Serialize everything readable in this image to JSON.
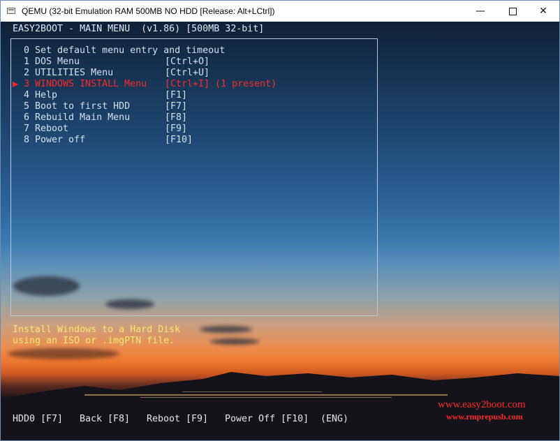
{
  "window": {
    "title": "QEMU (32-bit Emulation RAM 500MB NO HDD [Release: Alt+LCtrl])",
    "minimize_glyph": "—",
    "close_glyph": "✕"
  },
  "screen": {
    "header": "EASY2BOOT - MAIN MENU  (v1.86) [500MB 32-bit]",
    "menu": [
      {
        "num": "0",
        "label": "Set default menu entry and timeout",
        "key": ""
      },
      {
        "num": "1",
        "label": "DOS Menu",
        "key": "[Ctrl+O]"
      },
      {
        "num": "2",
        "label": "UTILITIES Menu",
        "key": "[Ctrl+U]"
      },
      {
        "num": "3",
        "label": "WINDOWS INSTALL Menu",
        "key": "[Ctrl+I] (1 present)"
      },
      {
        "num": "4",
        "label": "Help",
        "key": "[F1]"
      },
      {
        "num": "5",
        "label": "Boot to first HDD",
        "key": "[F7]"
      },
      {
        "num": "6",
        "label": "Rebuild Main Menu",
        "key": "[F8]"
      },
      {
        "num": "7",
        "label": "Reboot",
        "key": "[F9]"
      },
      {
        "num": "8",
        "label": "Power off",
        "key": "[F10]"
      }
    ],
    "selected_index": 3,
    "help_lines": [
      "Install Windows to a Hard Disk",
      "using an ISO or .imgPTN file."
    ],
    "footer": [
      "HDD0 [F7]",
      "Back [F8]",
      "Reboot [F9]",
      "Power Off [F10]",
      "(ENG)"
    ],
    "brand": {
      "line1": "www.easy2boot.com",
      "line2": "www.rmprepusb.com"
    }
  },
  "colors": {
    "menu_text": "#cfe0ee",
    "selected_text": "#ff2626",
    "help_text": "#f4e66a",
    "brand": "#ff2a2a"
  }
}
